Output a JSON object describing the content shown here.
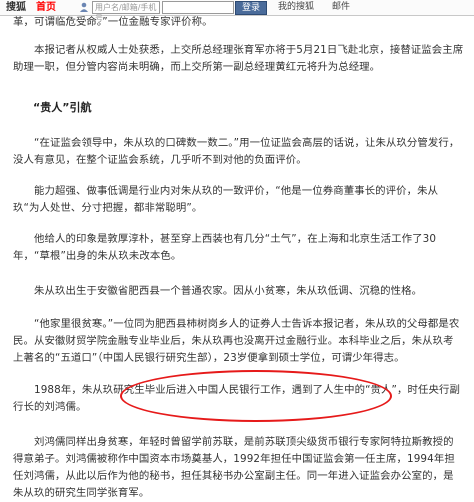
{
  "topbar": {
    "logo": "搜狐",
    "home": "首页",
    "user_icon": "user-icon",
    "username_placeholder": "用户名/邮箱/手机号",
    "password_placeholder": "",
    "login_label": "登录",
    "links": [
      "我的搜狐",
      "邮件"
    ],
    "colors": {
      "home": "#ff0000",
      "login_button": "#4a6b9a"
    }
  },
  "article": {
    "p0": "革，可谓临危受命。”一位金融专家评价称。",
    "p1": "本报记者从权威人士处获悉，上交所总经理张育军亦将于5月21日飞赴北京，接替证监会主席助理一职，但分管内容尚未明确，而上交所第一副总经理黄红元将升为总经理。",
    "heading": "“贵人”引航",
    "p2": "“在证监会领导中，朱从玖的口碑数一数二。”用一位证监会高层的话说，让朱从玖分管发行，没人有意见，在整个证监会系统，几乎听不到对他的负面评价。",
    "p3": "能力超强、做事低调是行业内对朱从玖的一致评价，“他是一位券商董事长的评价，朱从玖“为人处世、分寸把握，都非常聪明”。",
    "p4": "他给人的印象是敦厚淳朴，甚至穿上西装也有几分“土气”，在上海和北京生活工作了30年，“草根”出身的朱从玖未改本色。",
    "p5": "朱从玖出生于安徽省肥西县一个普通农家。因从小贫寒，朱从玖低调、沉稳的性格。",
    "p6": "“他家里很贫寒。”一位同为肥西县柿树岗乡人的证券人士告诉本报记者，朱从玖的父母都是农民。从安徽财贸学院金融专业毕业后，朱从玖再也没离开过金融行业。本科毕业之后，朱从玖考上著名的“五道口”（中国人民银行研究生部），23岁便拿到硕士学位，可谓少年得志。",
    "p7": "1988年，朱从玖研究生毕业后进入中国人民银行工作，遇到了人生中的“贵人”，时任央行副行长的刘鸿儒。",
    "p8": "刘鸿儒同样出身贫寒，年轻时曾留学前苏联，是前苏联顶尖级货币银行专家阿特拉斯教授的得意弟子。刘鸿儒被称作中国资本市场奠基人，1992年担任中国证监会第一任主席，1994年担任刘鸿儒，从此以后作为他的秘书，担任其秘书办公室副主任。同一年进入证监会办公室的，是朱从玖的研究生同学张育军。"
  }
}
